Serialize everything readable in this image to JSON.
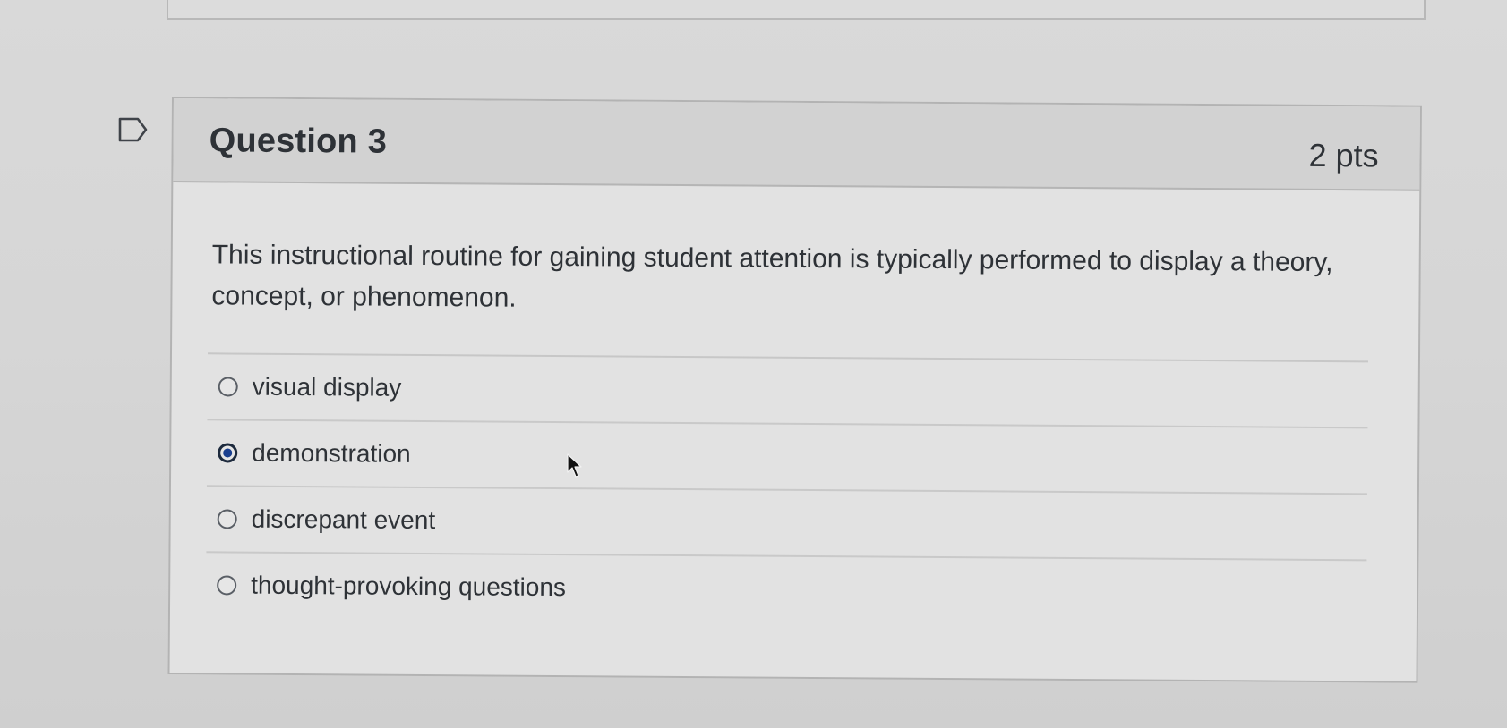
{
  "question": {
    "title": "Question 3",
    "points": "2 pts",
    "text": "This instructional routine for gaining student attention is typically performed to display a theory, concept, or phenomenon.",
    "flag_icon": "flag-bookmark-icon"
  },
  "answers": [
    {
      "label": "visual display",
      "selected": false
    },
    {
      "label": "demonstration",
      "selected": true
    },
    {
      "label": "discrepant event",
      "selected": false
    },
    {
      "label": "thought-provoking questions",
      "selected": false
    }
  ],
  "colors": {
    "background": "#d9d9d9",
    "card": "#e2e2e2",
    "header": "#d2d2d2",
    "text": "#2e3237",
    "selected_radio": "#1a3f8f"
  },
  "cursor_icon": "mouse-pointer-icon"
}
